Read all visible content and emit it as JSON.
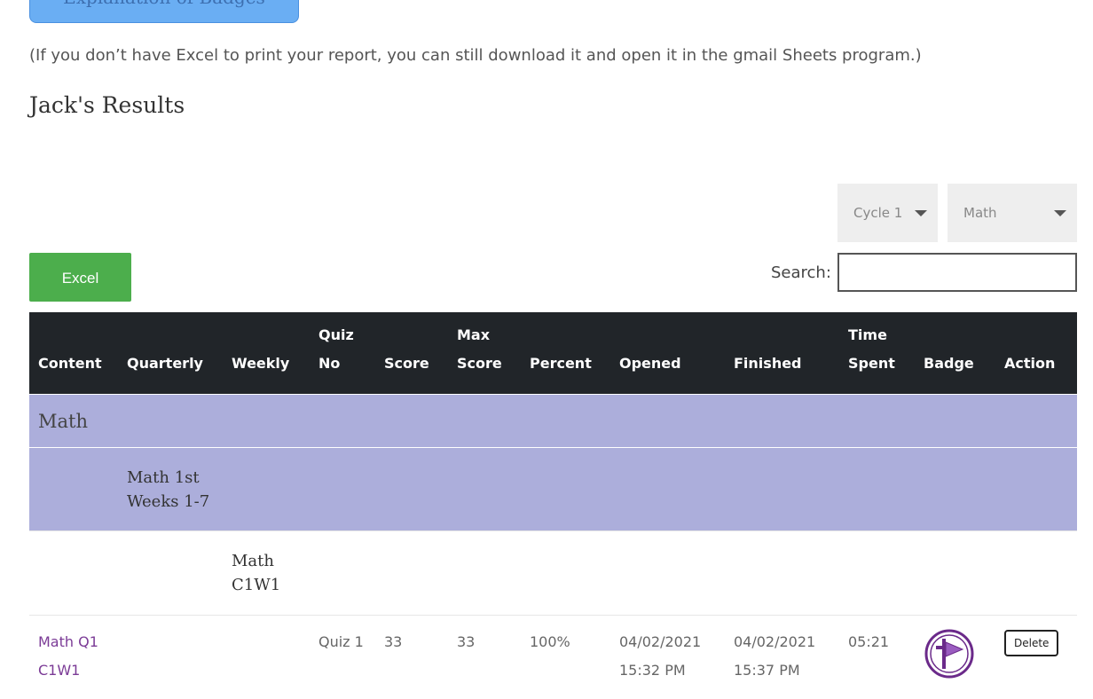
{
  "header": {
    "badges_button_label": "Explanation of Badges",
    "note": "(If you don’t have Excel to print your report, you can still download it and open it in the gmail Sheets program.)",
    "results_title": "Jack's Results"
  },
  "filters": {
    "cycle": "Cycle 1",
    "subject": "Math"
  },
  "toolbar": {
    "excel_label": "Excel",
    "search_label": "Search:",
    "search_value": ""
  },
  "table": {
    "columns": [
      {
        "line1": "",
        "line2": "Content"
      },
      {
        "line1": "",
        "line2": "Quarterly"
      },
      {
        "line1": "",
        "line2": "Weekly"
      },
      {
        "line1": "Quiz",
        "line2": "No"
      },
      {
        "line1": "",
        "line2": "Score"
      },
      {
        "line1": "Max",
        "line2": "Score"
      },
      {
        "line1": "",
        "line2": "Percent"
      },
      {
        "line1": "",
        "line2": "Opened"
      },
      {
        "line1": "",
        "line2": "Finished"
      },
      {
        "line1": "Time",
        "line2": "Spent"
      },
      {
        "line1": "",
        "line2": "Badge"
      },
      {
        "line1": "",
        "line2": "Action"
      }
    ],
    "subject_group": "Math",
    "quarter_group": {
      "line1": "Math 1st",
      "line2": "Weeks 1-7"
    },
    "week_group": {
      "line1": "Math",
      "line2": "C1W1"
    },
    "rows": [
      {
        "content_line1": "Math Q1",
        "content_line2": "C1W1",
        "quiz_no": "Quiz 1",
        "score": "33",
        "max_score": "33",
        "percent": "100%",
        "opened_date": "04/02/2021",
        "opened_time": "15:32 PM",
        "finished_date": "04/02/2021",
        "finished_time": "15:37 PM",
        "time_spent": "05:21",
        "badge_icon": "cross-flag-badge-icon",
        "action_label": "Delete"
      }
    ]
  },
  "colors": {
    "header_bg": "#212529",
    "group_bg": "#acaedb",
    "excel_green": "#4cae4c",
    "badge_button_blue": "#6aaef3",
    "link_purple": "#7b3b96",
    "badge_purple": "#6b2a8a"
  }
}
